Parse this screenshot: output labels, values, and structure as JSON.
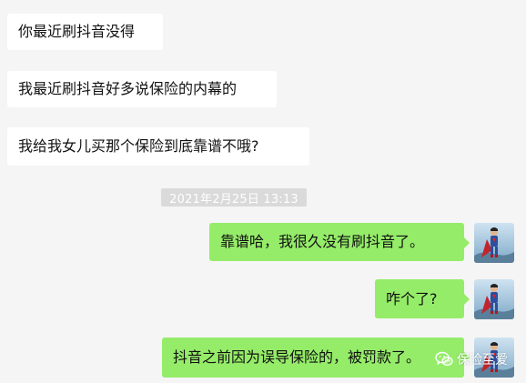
{
  "messages": [
    {
      "side": "left",
      "text": "你最近刷抖音没得"
    },
    {
      "side": "left",
      "text": "我最近刷抖音好多说保险的内幕的"
    },
    {
      "side": "left",
      "text": "我给我女儿买那个保险到底靠谱不哦?"
    },
    {
      "side": "right",
      "text": "靠谱哈，我很久没有刷抖音了。"
    },
    {
      "side": "right",
      "text": "咋个了?"
    },
    {
      "side": "right",
      "text": "抖音之前因为误导保险的，被罚款了。"
    }
  ],
  "timestamp": "2021年2月25日 13:13",
  "watermark": {
    "text": "保险至爱",
    "icon": "wechat-icon"
  },
  "colors": {
    "background": "#f5f5f5",
    "incoming_bubble": "#ffffff",
    "outgoing_bubble": "#95ec69",
    "timestamp_badge": "#dadada"
  }
}
